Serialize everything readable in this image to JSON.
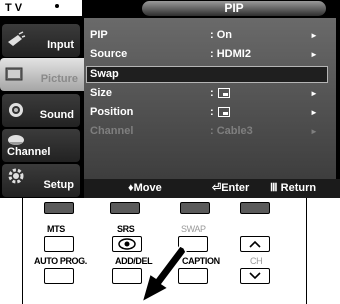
{
  "osd": {
    "source_label": "T V",
    "title": "PIP",
    "sidebar": [
      {
        "label": "Input",
        "icon": "input-plug-icon"
      },
      {
        "label": "Picture",
        "icon": "picture-icon",
        "active": true
      },
      {
        "label": "Sound",
        "icon": "speaker-icon"
      },
      {
        "label": "Channel",
        "icon": "satellite-dish-icon"
      },
      {
        "label": "Setup",
        "icon": "gear-icon"
      }
    ],
    "menu": [
      {
        "label": "PIP",
        "value": ": On",
        "arrow": "►"
      },
      {
        "label": "Source",
        "value": ": HDMI2",
        "arrow": "►"
      },
      {
        "label": "Swap",
        "value": "",
        "arrow": "",
        "selected": true
      },
      {
        "label": "Size",
        "value": ":",
        "arrow": "►"
      },
      {
        "label": "Position",
        "value": ":",
        "arrow": "►"
      },
      {
        "label": "Channel",
        "value": ": Cable3",
        "arrow": "►",
        "disabled": true
      }
    ],
    "nav": {
      "move": "♦Move",
      "enter": "⏎Enter",
      "return": "Ⅲ Return"
    }
  },
  "remote": {
    "buttons": {
      "mts": "MTS",
      "srs": "SRS",
      "swap": "SWAP",
      "auto_prog": "AUTO PROG.",
      "add_del": "ADD/DEL",
      "caption": "CAPTION",
      "ch": "CH"
    }
  },
  "colors": {
    "menu_bg": "#4a4a4a",
    "selected_border": "#b5b5b5",
    "disabled_text": "#7f7f7f"
  }
}
